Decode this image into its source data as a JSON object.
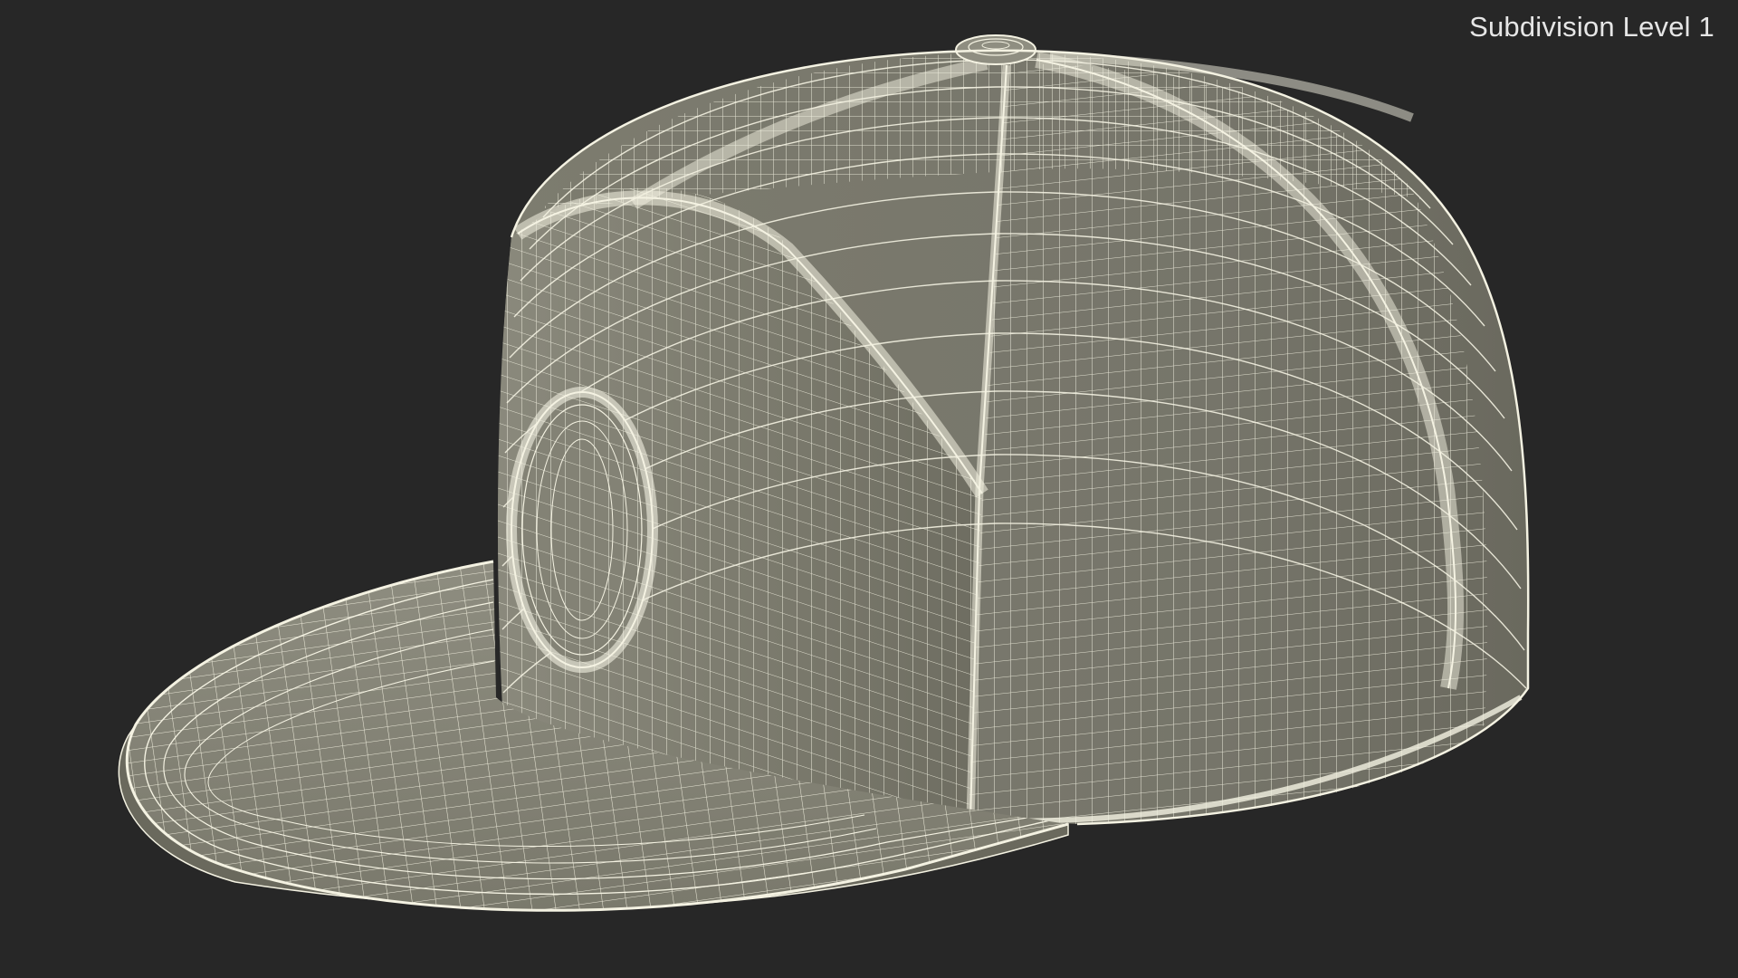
{
  "viewport": {
    "subdivision_label": "Subdivision Level 1",
    "background_color": "#272727"
  },
  "model": {
    "object": "snapback-cap-icon",
    "display_mode": "wireframe-on-shaded",
    "shade_color": "#7c7b6e",
    "wire_color": "#f4f2e2"
  }
}
